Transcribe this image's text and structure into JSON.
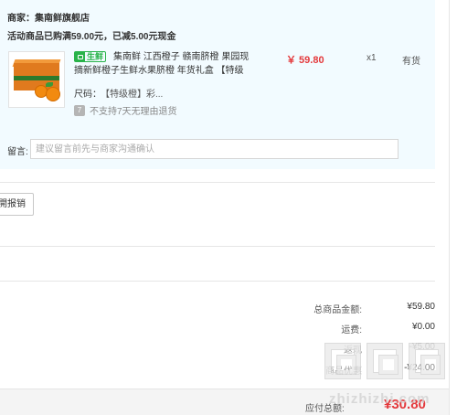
{
  "order": {
    "shop_label": "商家：",
    "shop_name": "集南鲜旗舰店",
    "promo": "活动商品已购满59.00元，已减5.00元现金",
    "item": {
      "fresh_tag": "生鲜",
      "title": "集南鲜 江西橙子 赣南脐橙 果园现摘新鲜橙子生鲜水果脐橙 年货礼盒 【特级",
      "spec_label": "尺码：",
      "spec_value": "【特级橙】彩...",
      "no_refund": "不支持7天无理由退货",
      "refund_icon": "7",
      "price": "￥ 59.80",
      "qty": "x1",
      "stock": "有货"
    },
    "remark_label": "留言:",
    "remark_placeholder": "建议留言前先与商家沟通确认"
  },
  "invoice": {
    "button_label": "開报销"
  },
  "summary": {
    "total_label": "总商品金额:",
    "total_value": "¥59.80",
    "shipping_label": "运费:",
    "shipping_value": "¥0.00",
    "row3_label": "返现",
    "row3_value": "-¥5.00",
    "row4_label": "商品优惠",
    "row4_value": "-¥24.00",
    "pay_label": "应付总额:",
    "pay_value": "¥30.80"
  },
  "watermark": {
    "text": "zhizhizhi.com"
  },
  "colors": {
    "price_red": "#e4393c",
    "fresh_green": "#29b34a",
    "block_bg": "#f2fbff"
  }
}
